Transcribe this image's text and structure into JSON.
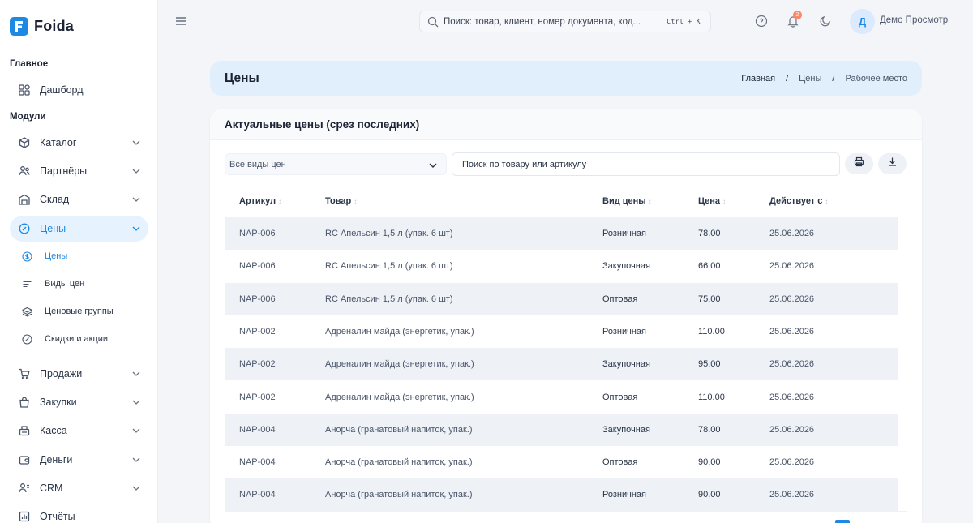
{
  "app": {
    "name": "Foida"
  },
  "sidebar": {
    "sections": [
      {
        "label": "Главное"
      },
      {
        "label": "Модули"
      }
    ],
    "items": [
      {
        "label": "Дашборд",
        "icon": "dashboard-icon"
      },
      {
        "label": "Каталог",
        "icon": "box-icon"
      },
      {
        "label": "Партнёры",
        "icon": "users-icon"
      },
      {
        "label": "Склад",
        "icon": "warehouse-icon"
      },
      {
        "label": "Цены",
        "icon": "tag-icon"
      },
      {
        "label": "Продажи",
        "icon": "cart-icon"
      },
      {
        "label": "Закупки",
        "icon": "bag-icon"
      },
      {
        "label": "Касса",
        "icon": "register-icon"
      },
      {
        "label": "Деньги",
        "icon": "wallet-icon"
      },
      {
        "label": "CRM",
        "icon": "crm-icon"
      },
      {
        "label": "Отчёты",
        "icon": "report-icon"
      }
    ],
    "subitems": [
      {
        "label": "Цены",
        "icon": "dollar-icon"
      },
      {
        "label": "Виды цен",
        "icon": "list-icon"
      },
      {
        "label": "Ценовые группы",
        "icon": "layers-icon"
      },
      {
        "label": "Скидки и акции",
        "icon": "discount-icon"
      }
    ]
  },
  "header": {
    "search_placeholder": "Поиск: товар, клиент, номер документа, код...",
    "shortcut": "Ctrl + K",
    "notifications_count": "2",
    "avatar_letter": "Д",
    "user_name": "Демо Просмотр"
  },
  "page": {
    "title": "Цены",
    "breadcrumb": [
      "Главная",
      "/",
      "Цены",
      "/",
      "Рабочее место"
    ]
  },
  "card": {
    "title": "Актуальные цены (срез последних)",
    "filter_value": "Все виды цен",
    "search_placeholder": "Поиск по товару или артикулу",
    "columns": [
      "Артикул",
      "Товар",
      "Вид цены",
      "Цена",
      "Действует с"
    ],
    "sort_glyph": "↕",
    "rows": [
      [
        "NAP-006",
        "RC Апельсин 1,5 л (упак. 6 шт)",
        "Розничная",
        "78.00",
        "25.06.2026"
      ],
      [
        "NAP-006",
        "RC Апельсин 1,5 л (упак. 6 шт)",
        "Закупочная",
        "66.00",
        "25.06.2026"
      ],
      [
        "NAP-006",
        "RC Апельсин 1,5 л (упак. 6 шт)",
        "Оптовая",
        "75.00",
        "25.06.2026"
      ],
      [
        "NAP-002",
        "Адреналин майда (энергетик, упак.)",
        "Розничная",
        "110.00",
        "25.06.2026"
      ],
      [
        "NAP-002",
        "Адреналин майда (энергетик, упак.)",
        "Закупочная",
        "95.00",
        "25.06.2026"
      ],
      [
        "NAP-002",
        "Адреналин майда (энергетик, упак.)",
        "Оптовая",
        "110.00",
        "25.06.2026"
      ],
      [
        "NAP-004",
        "Анорча (гранатовый напиток, упак.)",
        "Закупочная",
        "78.00",
        "25.06.2026"
      ],
      [
        "NAP-004",
        "Анорча (гранатовый напиток, упак.)",
        "Оптовая",
        "90.00",
        "25.06.2026"
      ],
      [
        "NAP-004",
        "Анорча (гранатовый напиток, упак.)",
        "Розничная",
        "90.00",
        "25.06.2026"
      ]
    ]
  },
  "colors": {
    "accent": "#1e88e5",
    "active_bg": "#e6f2fd",
    "banner_bg": "#e1effc",
    "badge": "#fa896b"
  }
}
